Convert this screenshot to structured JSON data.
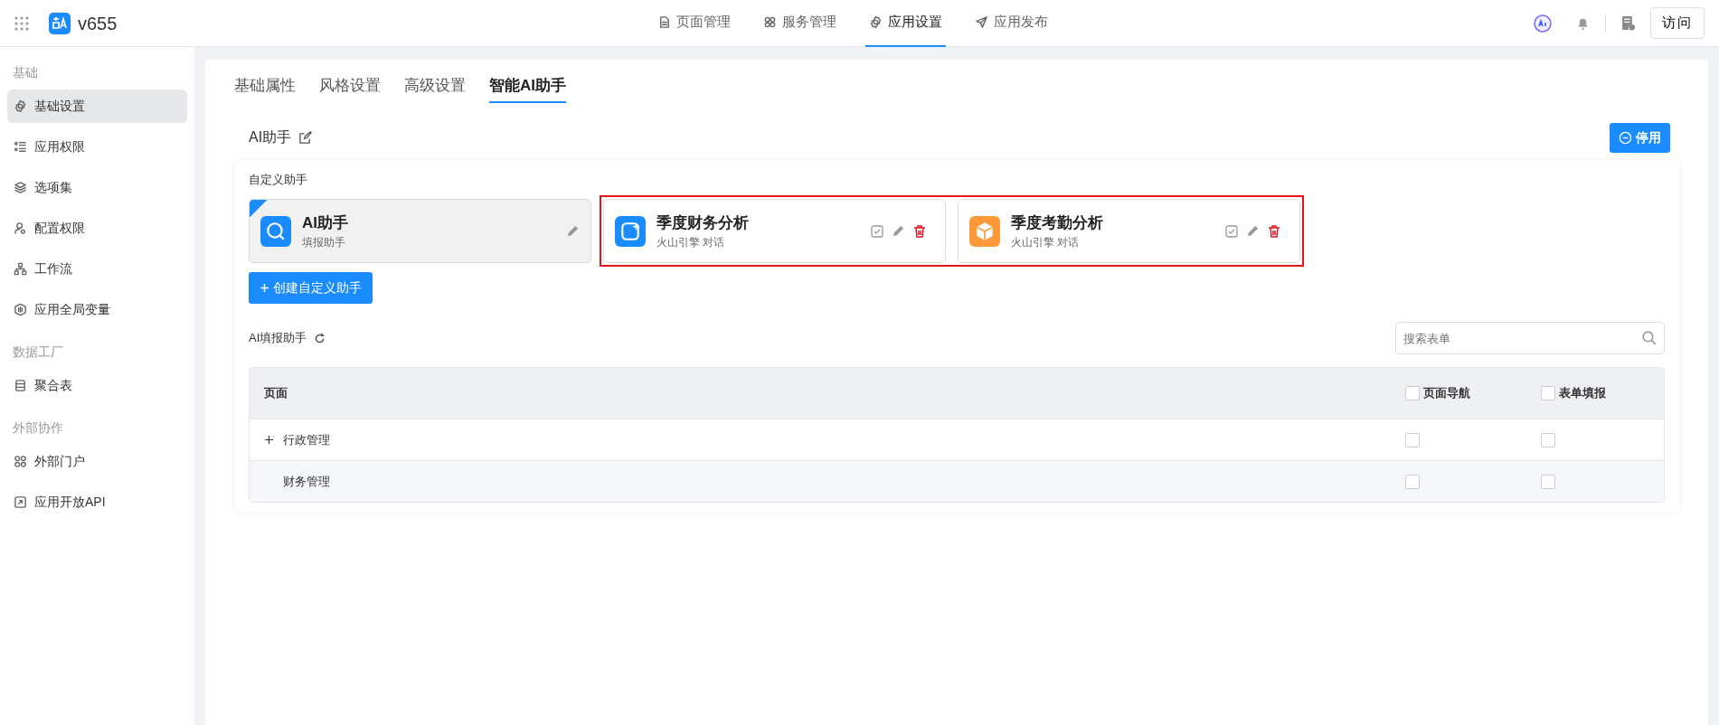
{
  "app": {
    "name": "v655"
  },
  "top_nav": [
    {
      "label": "页面管理",
      "selected": false
    },
    {
      "label": "服务管理",
      "selected": false
    },
    {
      "label": "应用设置",
      "selected": true
    },
    {
      "label": "应用发布",
      "selected": false
    }
  ],
  "visit_button": "访问",
  "sidebar": [
    {
      "kind": "heading",
      "label": "基础"
    },
    {
      "kind": "item",
      "label": "基础设置",
      "selected": true
    },
    {
      "kind": "item",
      "label": "应用权限",
      "selected": false
    },
    {
      "kind": "item",
      "label": "选项集",
      "selected": false
    },
    {
      "kind": "item",
      "label": "配置权限",
      "selected": false
    },
    {
      "kind": "item",
      "label": "工作流",
      "selected": false
    },
    {
      "kind": "item",
      "label": "应用全局变量",
      "selected": false
    },
    {
      "kind": "heading",
      "label": "数据工厂"
    },
    {
      "kind": "item",
      "label": "聚合表",
      "selected": false
    },
    {
      "kind": "heading",
      "label": "外部协作"
    },
    {
      "kind": "item",
      "label": "外部门户",
      "selected": false
    },
    {
      "kind": "item",
      "label": "应用开放API",
      "selected": false
    }
  ],
  "tabs": [
    {
      "label": "基础属性",
      "selected": false
    },
    {
      "label": "风格设置",
      "selected": false
    },
    {
      "label": "高级设置",
      "selected": false
    },
    {
      "label": "智能AI助手",
      "selected": true
    }
  ],
  "assistant": {
    "title": "AI助手",
    "disable_button": "停用"
  },
  "custom_section": {
    "title": "自定义助手",
    "cards": [
      {
        "kind": "default",
        "title": "AI助手",
        "subtitle": "填报助手",
        "color": "#1a8cff",
        "highlighted": false
      },
      {
        "kind": "custom",
        "title": "季度财务分析",
        "subtitle": "火山引擎 对话",
        "color": "#1a8cff",
        "highlighted": true
      },
      {
        "kind": "custom",
        "title": "季度考勤分析",
        "subtitle": "火山引擎 对话",
        "color": "#ff9838",
        "highlighted": true
      }
    ],
    "create_button": "创建自定义助手"
  },
  "fill_section": {
    "title": "AI填报助手",
    "search": {
      "placeholder": "搜索表单"
    },
    "table": {
      "columns": [
        {
          "label": "页面"
        },
        {
          "label": "页面导航",
          "checked": false
        },
        {
          "label": "表单填报",
          "checked": false
        }
      ],
      "rows": [
        {
          "name": "行政管理",
          "expanded": false,
          "nav": false,
          "fill": false
        },
        {
          "name": "财务管理",
          "nav": false,
          "fill": false
        }
      ]
    }
  }
}
